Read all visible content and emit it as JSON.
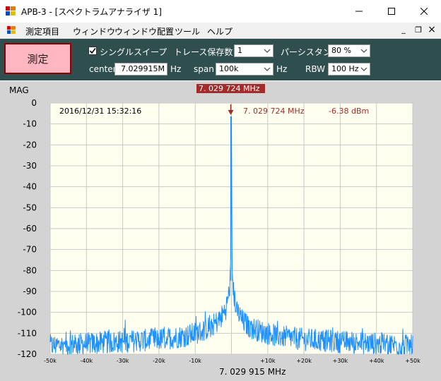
{
  "window": {
    "title": "APB-3 - [スペクトラムアナライザ 1]",
    "minimize_icon": "minimize-icon",
    "maximize_icon": "maximize-icon",
    "close_icon": "close-icon"
  },
  "menu": {
    "items": [
      "測定項目",
      "ウィンドウ",
      "ウィンドウ配置",
      "ツール",
      "ヘルプ"
    ],
    "mdi_minimize": "_",
    "mdi_restore": "❐",
    "mdi_close": "×"
  },
  "controls": {
    "measure_button": "測定",
    "single_sweep": {
      "label": "シングルスイープ",
      "checked": true
    },
    "trace_save_label": "トレース保存数",
    "trace_save_value": "1",
    "persistence_label": "パーシスタンス",
    "persistence_value": "80 %",
    "center_label": "center",
    "center_value": "7.029915M",
    "center_unit": "Hz",
    "span_label": "span",
    "span_value": "100k",
    "span_unit": "Hz",
    "rbw_label": "RBW",
    "rbw_value": "100 Hz"
  },
  "plot": {
    "marker_banner": "7. 029 724 MHz",
    "y_title": "MAG",
    "timestamp": "2016/12/31 15:32:16",
    "marker_freq": "7. 029 724 MHz",
    "marker_level": "-6.38 dBm",
    "center_freq_label": "7. 029 915 MHz",
    "colors": {
      "trace": "#1e90ff",
      "marker": "#a52a2a",
      "plot_bg": "#fffff0",
      "grid": "#c8c8c8"
    }
  },
  "chart_data": {
    "type": "line",
    "ylabel": "MAG",
    "ylim": [
      -120,
      0
    ],
    "xlim": [
      -50,
      50
    ],
    "y_ticks": [
      "0",
      "-10",
      "-20",
      "-30",
      "-40",
      "-50",
      "-60",
      "-70",
      "-80",
      "-90",
      "-100",
      "-110",
      "-120"
    ],
    "x_ticks": [
      "-50k",
      "-40k",
      "-30k",
      "-20k",
      "-10k",
      "",
      "+10k",
      "+20k",
      "+30k",
      "+40k",
      "+50k"
    ],
    "x_center_label": "7. 029 915 MHz",
    "series": [
      {
        "x_khz": [
          -50,
          -40,
          -30,
          -20,
          -12,
          -8,
          -5,
          -3,
          -1.5,
          -0.6,
          -0.2,
          0,
          0.2,
          0.6,
          1.5,
          3,
          5,
          8,
          12,
          20,
          30,
          40,
          50
        ],
        "y_dbm": [
          -116,
          -115,
          -114,
          -113,
          -111,
          -109,
          -106,
          -103,
          -98,
          -90,
          -80,
          -6.4,
          -80,
          -91,
          -99,
          -104,
          -107,
          -109,
          -111,
          -113,
          -114,
          -115,
          -116
        ]
      }
    ],
    "marker": {
      "x_khz": -0.19,
      "y_dbm": -6.38
    },
    "grid": true
  }
}
